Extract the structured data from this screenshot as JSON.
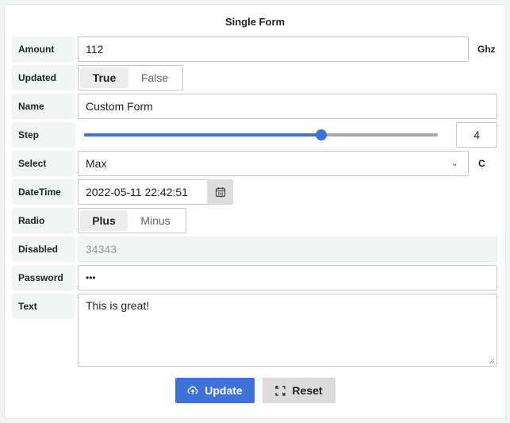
{
  "form": {
    "title": "Single Form",
    "amount": {
      "label": "Amount",
      "value": "112",
      "suffix": "Ghz"
    },
    "updated": {
      "label": "Updated",
      "options": [
        "True",
        "False"
      ],
      "selected": "True"
    },
    "name": {
      "label": "Name",
      "value": "Custom Form"
    },
    "step": {
      "label": "Step",
      "value": "4",
      "slider_fraction": 0.67
    },
    "select": {
      "label": "Select",
      "value": "Max",
      "suffix": "C"
    },
    "datetime": {
      "label": "DateTime",
      "value": "2022-05-11 22:42:51"
    },
    "radio": {
      "label": "Radio",
      "options": [
        "Plus",
        "Minus"
      ],
      "selected": "Plus"
    },
    "disabled": {
      "label": "Disabled",
      "value": "34343"
    },
    "password": {
      "label": "Password",
      "value": "•••"
    },
    "text": {
      "label": "Text",
      "value": "This is great!"
    }
  },
  "buttons": {
    "update": {
      "label": "Update",
      "icon": "cloud-upload-icon",
      "color": "#3d72d9"
    },
    "reset": {
      "label": "Reset",
      "icon": "reset-icon"
    }
  }
}
